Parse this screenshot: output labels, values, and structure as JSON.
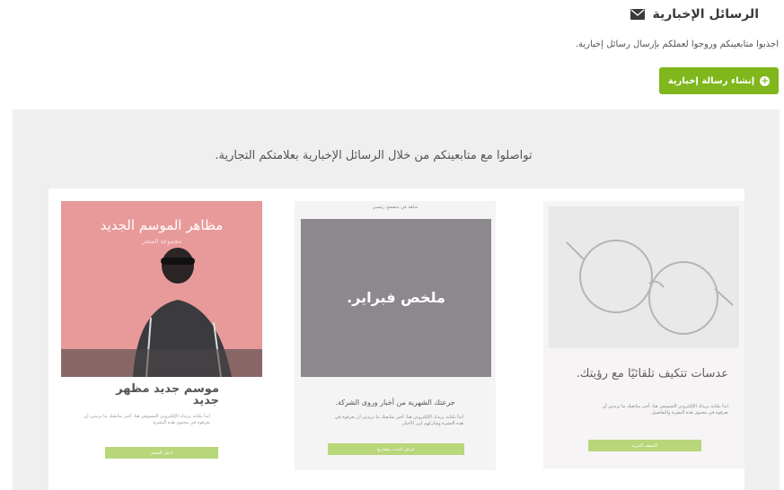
{
  "header": {
    "title": "الرسائل الإخبارية",
    "description": "اجذبوا متابعينكم وروجوا لعملكم بإرسال رسائل إخبارية.",
    "create_label": "إنشاء رسالة إخبارية"
  },
  "panel": {
    "title": "تواصلوا مع متابعينكم من خلال الرسائل الإخبارية بعلامتكم التجارية."
  },
  "cards": {
    "glasses": {
      "title": "عدسات تتكيف تلقائيًا مع رؤيتك.",
      "body": "ابدأ بكتابة بريدك الإلكتروني التسويقي هنا. أخبر متابعيك ما تريدين أن يعرفوه في محتوى هذه النشرة والتفاصيل.",
      "button": "اكتشف المزيد"
    },
    "feb": {
      "top": "شاهد في متصفح رئيسي",
      "image_text": "ملخص فبراير.",
      "subtitle": "جرعتك الشهرية من أخبار وروى الشركة.",
      "body": "ابدأ بكتابة بريدك الإلكتروني هنا. أخبر متابعيك ما تريدين أن يعرفوه في هذه النشرة وشاركهم أبرز الأخبار.",
      "button": "عرض أحدث مشاريع"
    },
    "fashion": {
      "image_title": "مظاهر الموسم الجديد",
      "image_sub": "مجموعة المتجر",
      "heading": "موسم جديد مظهر جديد",
      "body": "ابدأ بكتابة بريدك الإلكتروني التسويقي هنا. أخبر متابعيك ما تريدين أن يعرفوه في محتوى هذه النشرة.",
      "button": "ادخل المتجر"
    }
  },
  "colors": {
    "accent": "#7fb71c",
    "panel_bg": "#efefef"
  }
}
